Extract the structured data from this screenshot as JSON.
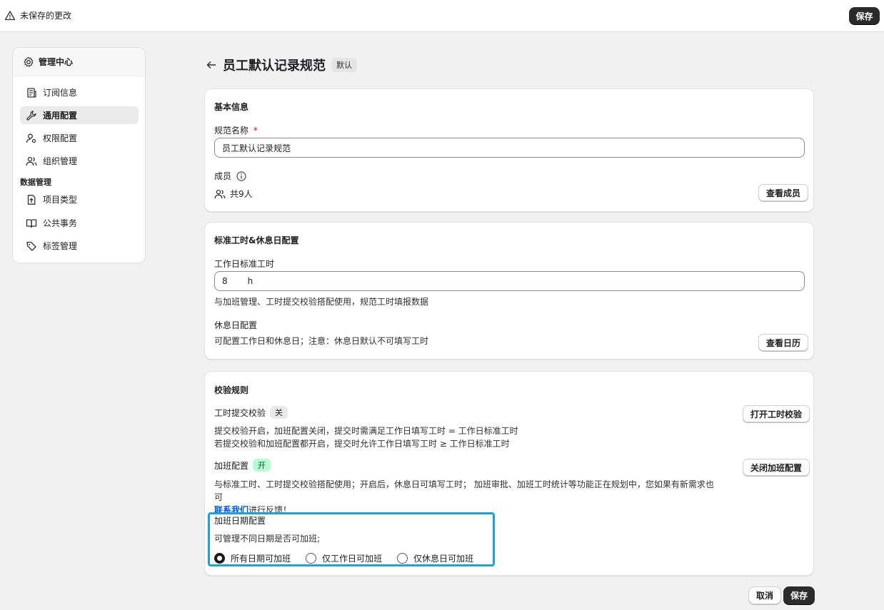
{
  "topbar": {
    "unsaved": "未保存的更改",
    "save": "保存"
  },
  "sidebar": {
    "title": "管理中心",
    "items": [
      {
        "label": "订阅信息",
        "icon": "receipt-icon"
      },
      {
        "label": "通用配置",
        "icon": "wrench-icon"
      },
      {
        "label": "权限配置",
        "icon": "user-key-icon"
      },
      {
        "label": "组织管理",
        "icon": "users-icon"
      }
    ],
    "group_label": "数据管理",
    "data_items": [
      {
        "label": "项目类型",
        "icon": "file-upload-icon"
      },
      {
        "label": "公共事务",
        "icon": "book-icon"
      },
      {
        "label": "标签管理",
        "icon": "tag-icon"
      }
    ]
  },
  "page": {
    "title": "员工默认记录规范",
    "badge": "默认"
  },
  "basic": {
    "title": "基本信息",
    "name_label": "规范名称",
    "required_mark": "*",
    "name_value": "员工默认记录规范",
    "members_label": "成员",
    "members_count": "共9人",
    "view_members": "查看成员"
  },
  "hours": {
    "title": "标准工时&休息日配置",
    "workday_label": "工作日标准工时",
    "workday_value": "8",
    "unit": "h",
    "workday_help": "与加班管理、工时提交校验搭配使用，规范工时填报数据",
    "rest_label": "休息日配置",
    "rest_help": "可配置工作日和休息日；注意：休息日默认不可填写工时",
    "view_calendar": "查看日历"
  },
  "rules": {
    "title": "校验规则",
    "submit_label": "工时提交校验",
    "submit_state": "关",
    "submit_help_1": "提交校验开启，加班配置关闭，提交时需满足工作日填写工时 = 工作日标准工时",
    "submit_help_2": "若提交校验和加班配置都开启，提交时允许工作日填写工时 ≥ 工作日标准工时",
    "open_check": "打开工时校验",
    "overtime_label": "加班配置",
    "overtime_state": "开",
    "overtime_help": "与标准工时、工时提交校验搭配使用；开启后，休息日可填写工时； 加班审批、加班工时统计等功能正在规划中，您如果有新需求也可",
    "contact": "联系我们",
    "feedback": "进行反馈！",
    "close_overtime": "关闭加班配置",
    "date_title": "加班日期配置",
    "date_help": "可管理不同日期是否可加班;",
    "options": [
      "所有日期可加班",
      "仅工作日可加班",
      "仅休息日可加班"
    ],
    "selected": 0
  },
  "footer": {
    "cancel": "取消",
    "save": "保存"
  }
}
